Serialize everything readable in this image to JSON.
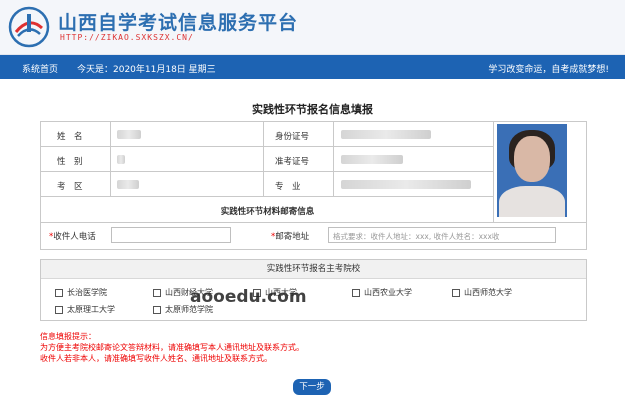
{
  "header": {
    "title": "山西自学考试信息服务平台",
    "url": "HTTP://ZIKAO.SXKSZX.CN/"
  },
  "nav": {
    "home": "系统首页",
    "date": "今天是：2020年11月18日   星期三",
    "slogan": "学习改变命运，自考成就梦想!"
  },
  "form": {
    "title": "实践性环节报名信息填报",
    "labels": {
      "name": "姓　名",
      "gender": "性　别",
      "area": "考　区",
      "id": "身份证号",
      "ticket": "准考证号",
      "major": "专　业"
    },
    "mail_section": "实践性环节材料邮寄信息",
    "phone_label": "收件人电话",
    "address_label": "邮寄地址",
    "address_placeholder": "格式要求：收件人地址：xxx, 收件人姓名：xxx收"
  },
  "schools": {
    "heading": "实践性环节报名主考院校",
    "row1": [
      "长治医学院",
      "山西财经大学",
      "山西大学",
      "山西农业大学",
      "山西师范大学"
    ],
    "row2": [
      "太原理工大学",
      "太原师范学院"
    ]
  },
  "tips": {
    "title": "信息填报提示：",
    "line1": "为方便主考院校邮寄论文答辩材料，请准确填写本人通讯地址及联系方式。",
    "line2": "收件人若非本人，请准确填写收件人姓名、通讯地址及联系方式。"
  },
  "next_button": "下一步",
  "watermark": "aooedu.com",
  "colors": {
    "accent": "#1d63b3",
    "warning": "#e00000"
  }
}
